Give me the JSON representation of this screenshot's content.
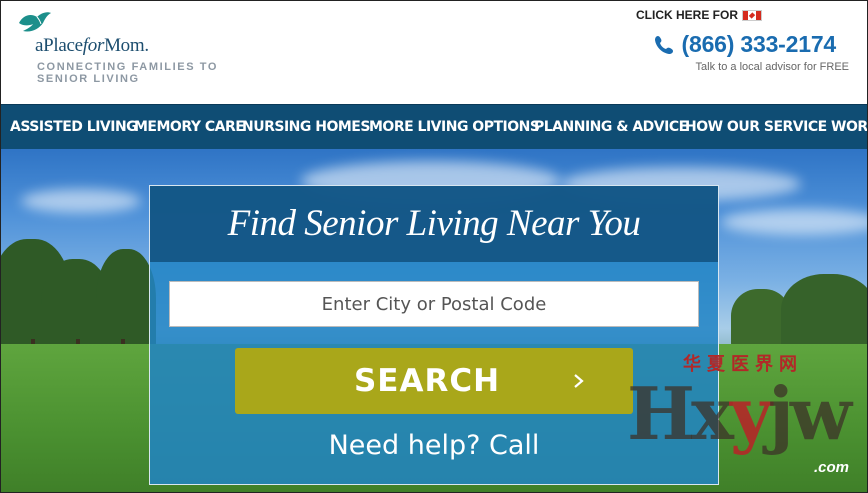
{
  "header": {
    "logo_text_a": "a",
    "logo_text_place": "Place",
    "logo_text_for": "for",
    "logo_text_mom": "Mom.",
    "tagline": "CONNECTING FAMILIES TO SENIOR LIVING",
    "canada_link": "CLICK HERE FOR",
    "phone": "(866) 333-2174",
    "advisor_text": "Talk to a local advisor for FREE"
  },
  "nav": {
    "items": [
      {
        "label": "ASSISTED LIVING"
      },
      {
        "label": "MEMORY CARE"
      },
      {
        "label": "NURSING HOMES"
      },
      {
        "label": "MORE LIVING OPTIONS"
      },
      {
        "label": "PLANNING & ADVICE"
      },
      {
        "label": "HOW OUR SERVICE WORKS"
      }
    ]
  },
  "search": {
    "title": "Find Senior Living Near You",
    "placeholder": "Enter City or Postal Code",
    "button_label": "SEARCH",
    "help_text": "Need help? Call"
  },
  "watermark": {
    "chinese": "华夏医界网",
    "main_a": "Hx",
    "main_r": "y",
    "main_b": "jw",
    "domain": ".com"
  },
  "colors": {
    "nav_bg": "#0f4d74",
    "phone": "#1a6cb0",
    "search_button": "#a9a71a",
    "panel": "#2184c4"
  },
  "icons": {
    "logo": "dove-icon",
    "phone": "phone-icon",
    "flag": "canada-flag-icon",
    "chevron": "chevron-right-icon"
  }
}
